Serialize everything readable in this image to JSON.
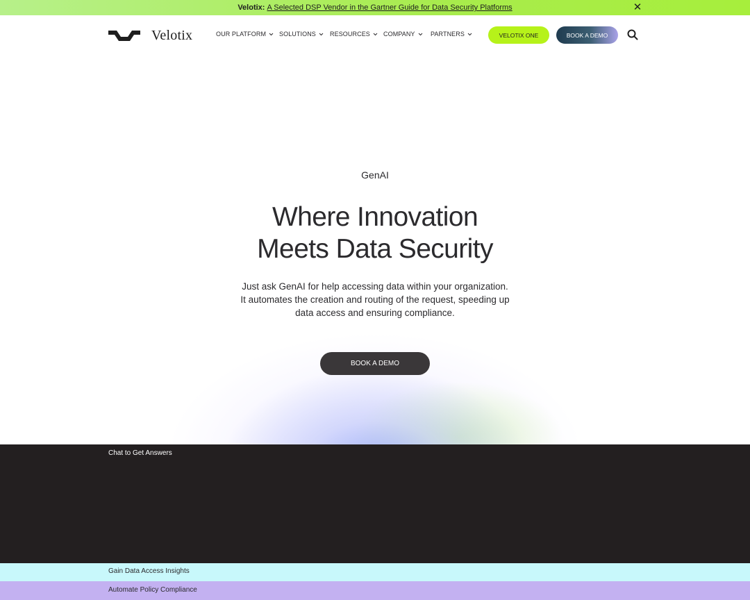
{
  "announcement": {
    "prefix": "Velotix:",
    "link_text": "A Selected DSP Vendor in the Gartner Guide for Data Security Platforms",
    "close_icon": "close-icon",
    "background": "#a8ec4c"
  },
  "header": {
    "logo_text": "Velotix",
    "nav": [
      {
        "label": "OUR PLATFORM"
      },
      {
        "label": "SOLUTIONS"
      },
      {
        "label": "RESOURCES"
      },
      {
        "label": "COMPANY"
      },
      {
        "label": "PARTNERS"
      }
    ],
    "velotix_one_label": "VELOTIX ONE",
    "book_demo_label": "BOOK A DEMO",
    "search_icon": "search-icon"
  },
  "hero": {
    "eyebrow": "GenAI",
    "headline_line1": "Where Innovation",
    "headline_line2": "Meets Data Security",
    "sub_line1": "Just ask GenAI for help accessing data within your organization.",
    "sub_line2": "It automates the creation and routing of the request, speeding up",
    "sub_line3": "data access and ensuring compliance.",
    "cta_label": "BOOK A DEMO"
  },
  "sections": {
    "chat": "Chat to Get Answers",
    "insights": "Gain Data Access Insights",
    "compliance": "Automate Policy Compliance"
  },
  "colors": {
    "accent_green": "#b6f21a",
    "dark": "#231f20",
    "cyan": "#c8f8fb",
    "purple": "#c3b1f1"
  }
}
